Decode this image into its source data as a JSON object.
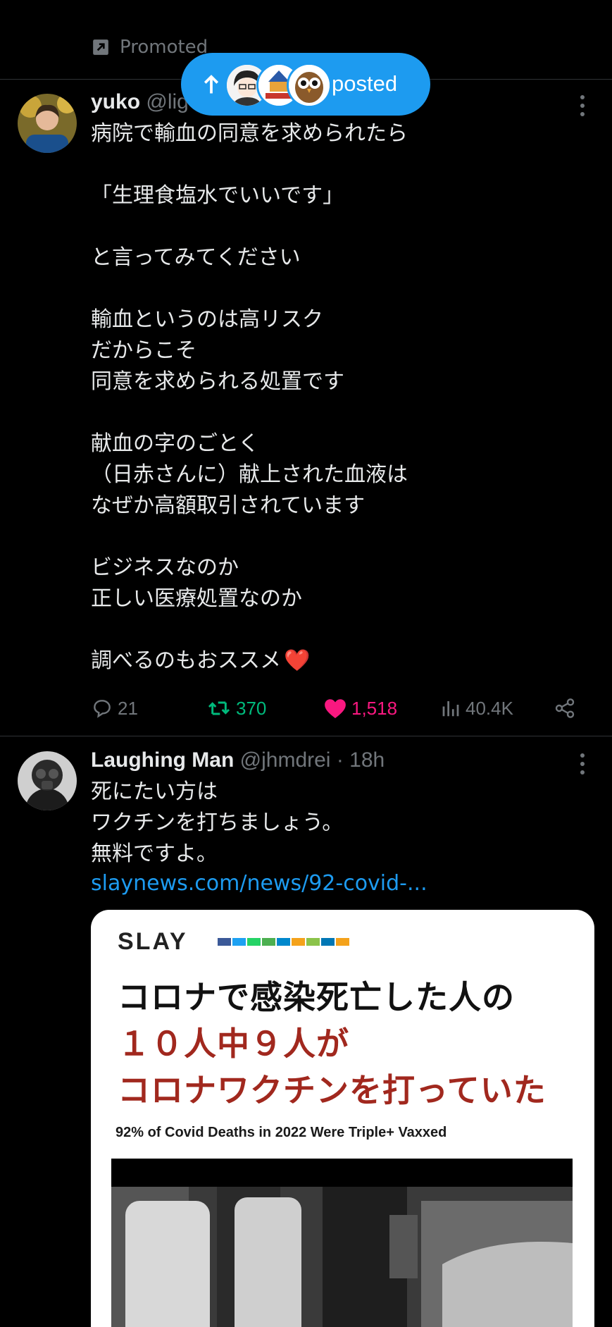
{
  "promoted": {
    "label": "Promoted"
  },
  "pill": {
    "label": "posted"
  },
  "tweet1": {
    "name": "yuko",
    "handle": "@lig",
    "lines": "病院で輸血の同意を求められたら\n\n「生理食塩水でいいです」\n\nと言ってみてください\n\n輸血というのは高リスク\nだからこそ\n同意を求められる処置です\n\n献血の字のごとく\n（日赤さんに）献上された血液は\nなぜか高額取引されています\n\nビジネスなのか\n正しい医療処置なのか\n\n調べるのもおススメ",
    "emoji": "❤️",
    "replies": "21",
    "reposts": "370",
    "likes": "1,518",
    "views": "40.4K"
  },
  "tweet2": {
    "name": "Laughing Man",
    "handle": "@jhmdrei",
    "time": "· 18h",
    "lines": "死にたい方は\nワクチンを打ちましょう。\n無料ですよ。",
    "link": "slaynews.com/news/92-covid-...",
    "card": {
      "brand": "SLAY",
      "headline1": "コロナで感染死亡した人の",
      "headline2": "１０人中９人が",
      "headline3": "コロナワクチンを打っていた",
      "subtitle": "92% of Covid Deaths in 2022 Were Triple+ Vaxxed"
    }
  },
  "colors": {
    "accent": "#1d9bf0",
    "repost": "#00ba7c",
    "like": "#f91880",
    "muted": "#71767b",
    "headline_red": "#a1281e"
  }
}
